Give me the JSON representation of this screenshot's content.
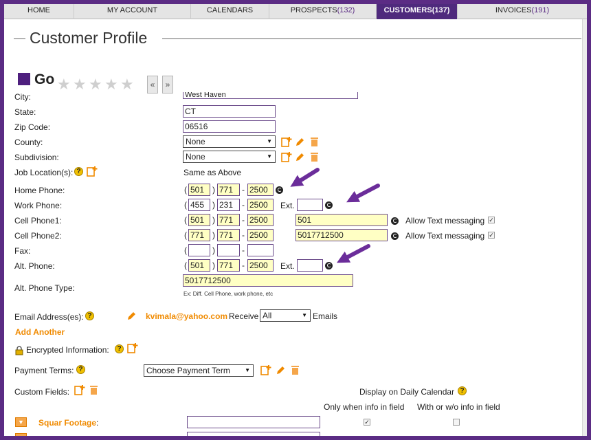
{
  "nav": {
    "tabs": [
      {
        "label": "HOME",
        "count": ""
      },
      {
        "label": "MY ACCOUNT",
        "count": ""
      },
      {
        "label": "CALENDARS",
        "count": ""
      },
      {
        "label": "PROSPECTS",
        "count": "(132)"
      },
      {
        "label": "CUSTOMERS",
        "count": "(137)"
      },
      {
        "label": "INVOICES",
        "count": "(191)"
      }
    ],
    "active": "CUSTOMERS"
  },
  "page": {
    "title": "Customer Profile"
  },
  "customer": {
    "name": "Go",
    "rating": 0,
    "rating_max": 5
  },
  "pager": {
    "prev": "«",
    "next": "»"
  },
  "fields": {
    "city": {
      "label": "City:",
      "value": "West Haven"
    },
    "state": {
      "label": "State:",
      "value": "CT"
    },
    "zip": {
      "label": "Zip Code:",
      "value": "06516"
    },
    "county": {
      "label": "County:",
      "value": "None"
    },
    "subdivision": {
      "label": "Subdivision:",
      "value": "None"
    },
    "job_location": {
      "label": "Job Location(s):",
      "value": "Same as Above"
    },
    "home_phone": {
      "label": "Home Phone:",
      "area": "501",
      "prefix": "771",
      "line": "2500"
    },
    "work_phone": {
      "label": "Work Phone:",
      "area": "455",
      "prefix": "231",
      "line": "2500",
      "ext_label": "Ext.",
      "ext": ""
    },
    "cell_phone1": {
      "label": "Cell Phone1:",
      "area": "501",
      "prefix": "771",
      "line": "2500",
      "extra": "501",
      "text_label": "Allow Text messaging",
      "text_allowed": true
    },
    "cell_phone2": {
      "label": "Cell Phone2:",
      "area": "771",
      "prefix": "771",
      "line": "2500",
      "extra": "5017712500",
      "text_label": "Allow Text messaging",
      "text_allowed": true
    },
    "fax": {
      "label": "Fax:",
      "area": "",
      "prefix": "",
      "line": ""
    },
    "alt_phone": {
      "label": "Alt. Phone:",
      "area": "501",
      "prefix": "771",
      "line": "2500",
      "ext_label": "Ext.",
      "ext": ""
    },
    "alt_phone_type": {
      "label": "Alt. Phone Type:",
      "value": "5017712500",
      "hint": "Ex: Diff. Cell Phone, work phone, etc"
    },
    "email": {
      "label": "Email Address(es):",
      "value": "kvimala@yahoo.com",
      "receive_label": "Receive",
      "receive_value": "All",
      "emails_label": "Emails",
      "add_another": "Add Another"
    },
    "encrypted": {
      "label": "Encrypted Information:"
    },
    "payment_terms": {
      "label": "Payment Terms:",
      "value": "Choose Payment Term"
    },
    "custom_fields": {
      "label": "Custom Fields:",
      "display_label": "Display on Daily Calendar",
      "col1": "Only when info in field",
      "col2": "With or w/o info in field",
      "rows": [
        {
          "name": "Squar Footage",
          "colon": ":",
          "value": "",
          "only_when": true,
          "always": false
        }
      ]
    }
  },
  "punct": {
    "open": "(",
    "close": ")",
    "dash": "-"
  },
  "colors": {
    "accent": "#4f2a7d",
    "frame": "#5b2c84",
    "highlight": "#ffffc4",
    "orange": "#f08a00"
  }
}
